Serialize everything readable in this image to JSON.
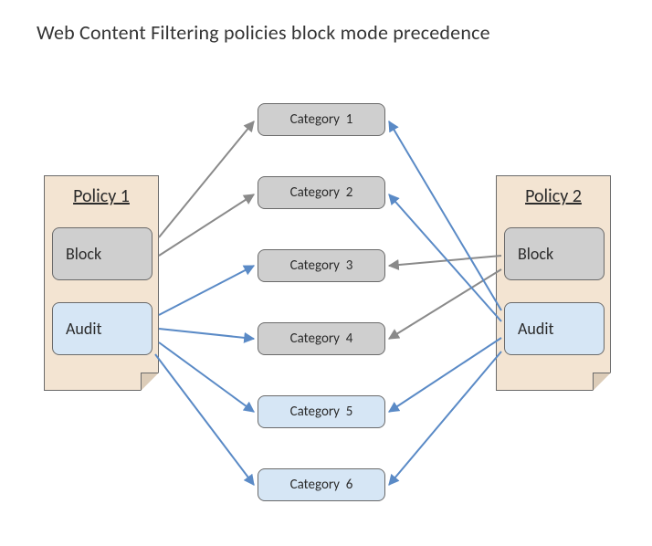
{
  "title": "Web Content Filtering policies block mode precedence",
  "policies": {
    "left": {
      "title": "Policy 1",
      "block_label": "Block",
      "audit_label": "Audit"
    },
    "right": {
      "title": "Policy 2",
      "block_label": "Block",
      "audit_label": "Audit"
    }
  },
  "categories": {
    "c1": "Category  1",
    "c2": "Category  2",
    "c3": "Category  3",
    "c4": "Category  4",
    "c5": "Category  5",
    "c6": "Category  6"
  },
  "colors": {
    "gray_arrow": "#8A8A8A",
    "blue_arrow": "#5A8AC6",
    "gray_fill": "#CFCFCF",
    "blue_fill": "#D6E6F5",
    "frame_fill": "#F3E4D2",
    "stroke": "#6A6A6A"
  },
  "connections": [
    {
      "from": "policy1.block",
      "to": "c1",
      "type": "block"
    },
    {
      "from": "policy1.block",
      "to": "c2",
      "type": "block"
    },
    {
      "from": "policy1.audit",
      "to": "c3",
      "type": "audit"
    },
    {
      "from": "policy1.audit",
      "to": "c4",
      "type": "audit"
    },
    {
      "from": "policy1.audit",
      "to": "c5",
      "type": "audit"
    },
    {
      "from": "policy1.audit",
      "to": "c6",
      "type": "audit"
    },
    {
      "from": "policy2.block",
      "to": "c3",
      "type": "block"
    },
    {
      "from": "policy2.block",
      "to": "c4",
      "type": "block"
    },
    {
      "from": "policy2.audit",
      "to": "c1",
      "type": "audit"
    },
    {
      "from": "policy2.audit",
      "to": "c2",
      "type": "audit"
    },
    {
      "from": "policy2.audit",
      "to": "c5",
      "type": "audit"
    },
    {
      "from": "policy2.audit",
      "to": "c6",
      "type": "audit"
    }
  ]
}
